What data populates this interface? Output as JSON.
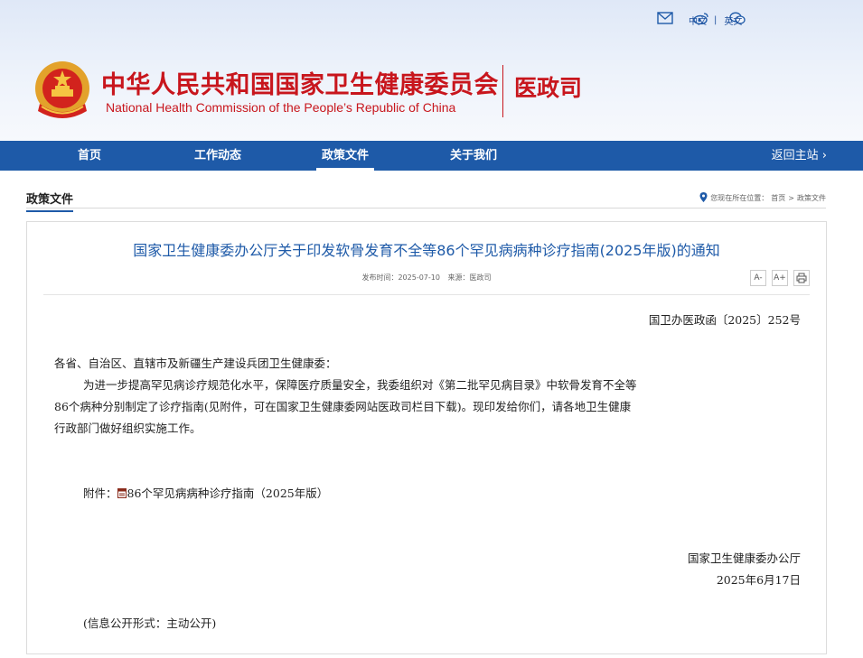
{
  "header": {
    "title_cn": "中华人民共和国国家卫生健康委员会",
    "title_en": "National Health Commission of the People’s  Republic of China",
    "dept": "医政司",
    "lang_cn": "中文",
    "lang_sep": "|",
    "lang_en": "英文",
    "icons": [
      "mail-icon",
      "weibo-icon",
      "wechat-icon"
    ]
  },
  "nav": {
    "items": [
      {
        "label": "首页"
      },
      {
        "label": "工作动态"
      },
      {
        "label": "政策文件",
        "active": true
      },
      {
        "label": "关于我们"
      }
    ],
    "back_label": "返回主站 ›"
  },
  "breadcrumb": {
    "section_title": "政策文件",
    "location_label": "您现在所在位置：",
    "home": "首页",
    "sep": ">",
    "current": "政策文件"
  },
  "article": {
    "title": "国家卫生健康委办公厅关于印发软骨发育不全等86个罕见病病种诊疗指南(2025年版)的通知",
    "publish_label": "发布时间：",
    "publish_date": "2025-07-10",
    "source_label": "来源：",
    "source": "医政司",
    "tools": [
      "A-",
      "A+",
      "print"
    ],
    "doc_number": "国卫办医政函〔2025〕252号",
    "salutation": "各省、自治区、直辖市及新疆生产建设兵团卫生健康委：",
    "para_line1": "为进一步提高罕见病诊疗规范化水平，保障医疗质量安全，我委组织对《第二批罕见病目录》中软骨发育不全等",
    "para_line2": "86个病种分别制定了诊疗指南(见附件，可在国家卫生健康委网站医政司栏目下载)。现印发给你们，请各地卫生健康",
    "para_line3": "行政部门做好组织实施工作。",
    "attach_label": "附件：",
    "attach_link": "86个罕见病病种诊疗指南（2025年版）",
    "signer": "国家卫生健康委办公厅",
    "sign_date": "2025年6月17日",
    "disclosure": "(信息公开形式：主动公开)"
  },
  "colors": {
    "brand_red": "#c8161d",
    "nav_blue": "#1e5aa8"
  }
}
